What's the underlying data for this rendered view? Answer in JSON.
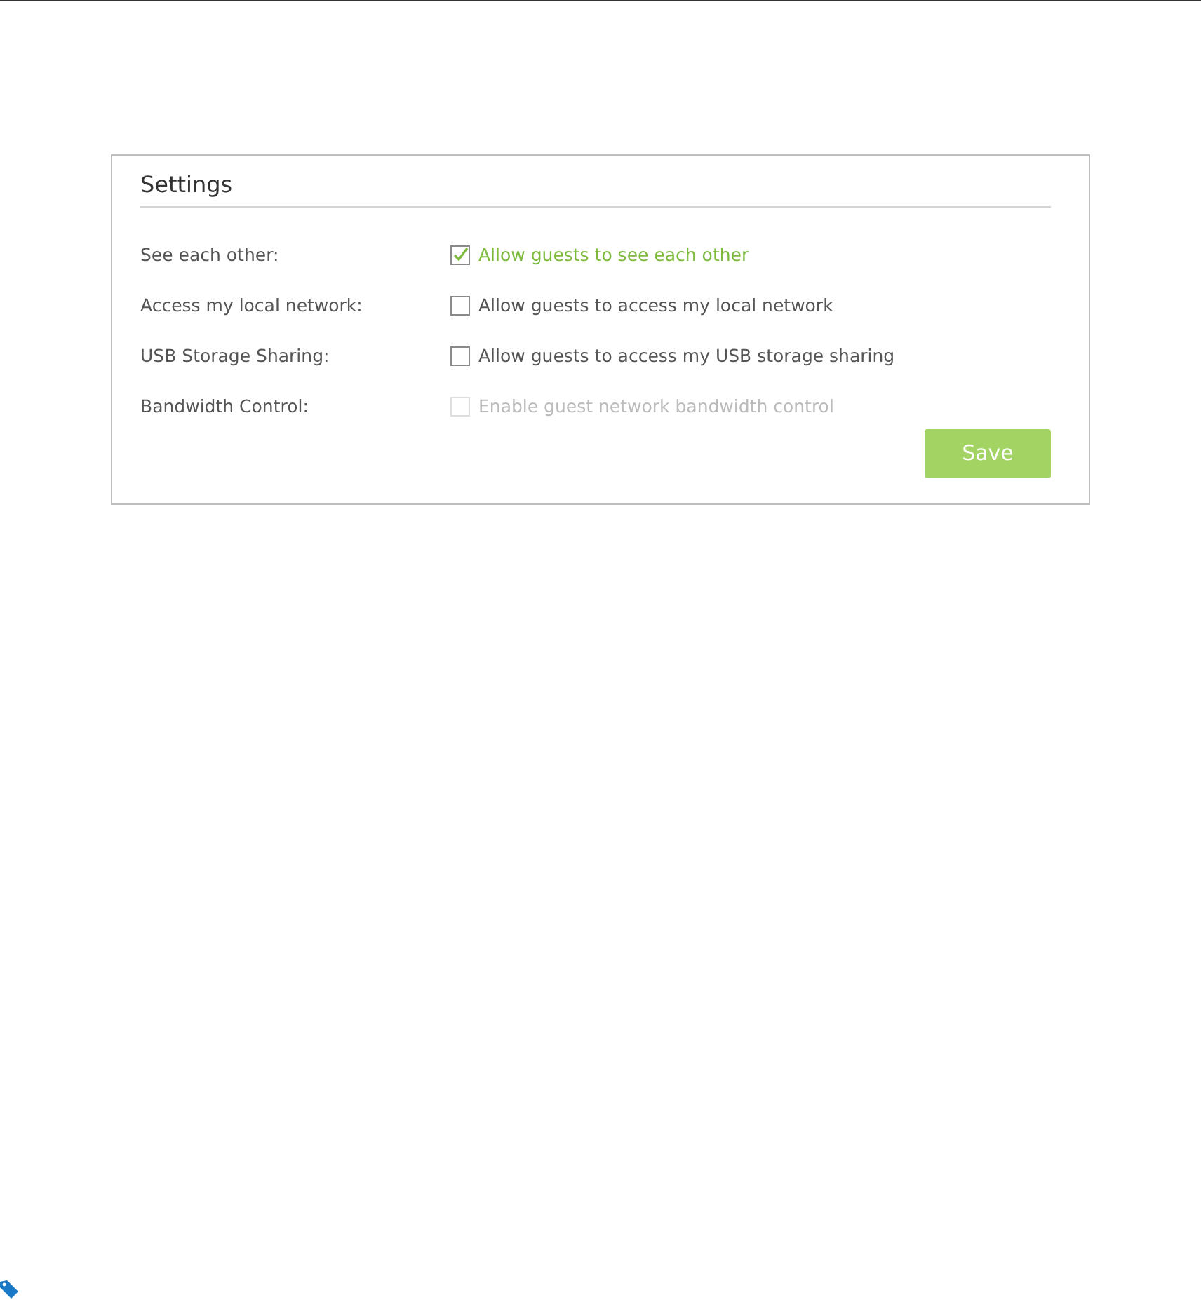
{
  "panel": {
    "title": "Settings"
  },
  "rows": [
    {
      "label": "See each other:",
      "option": "Allow guests to see each other",
      "checked": true,
      "disabled": false
    },
    {
      "label": "Access my local network:",
      "option": "Allow guests to access my local network",
      "checked": false,
      "disabled": false
    },
    {
      "label": "USB Storage Sharing:",
      "option": "Allow guests to access my USB storage sharing",
      "checked": false,
      "disabled": false
    },
    {
      "label": "Bandwidth Control:",
      "option": "Enable guest network bandwidth control",
      "checked": false,
      "disabled": true
    }
  ],
  "buttons": [
    {
      "label": "Save"
    }
  ]
}
